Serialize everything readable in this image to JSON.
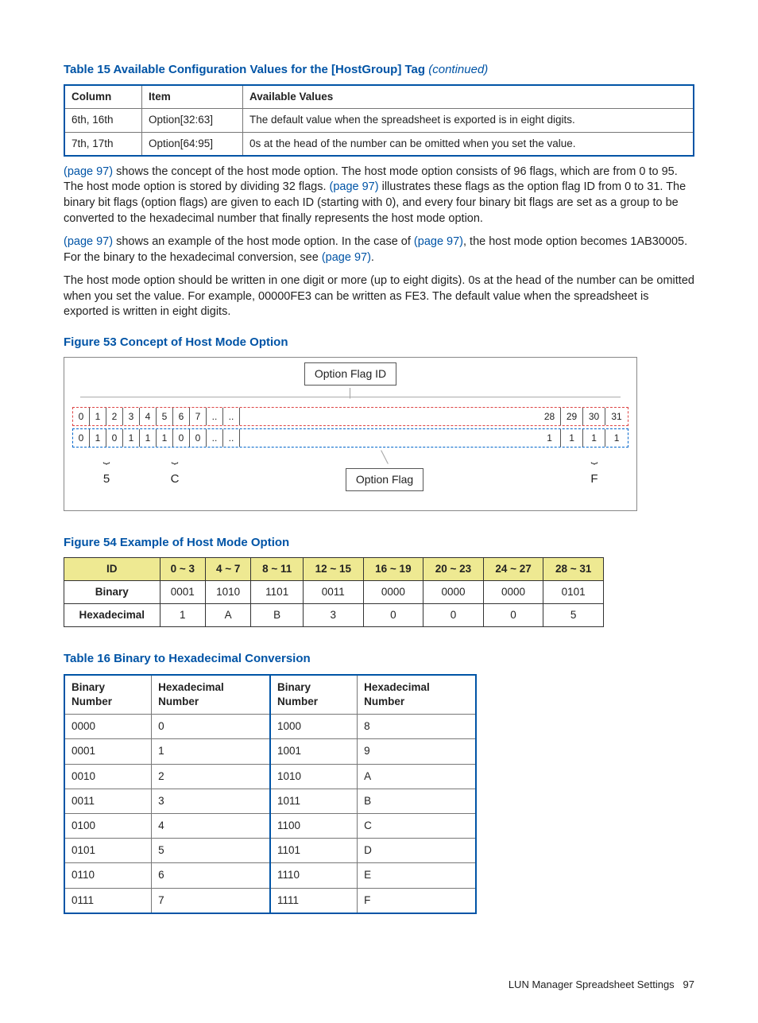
{
  "table15": {
    "caption": "Table 15 Available Configuration Values for the [HostGroup] Tag",
    "cont": "(continued)",
    "headers": [
      "Column",
      "Item",
      "Available Values"
    ],
    "rows": [
      [
        "6th, 16th",
        "Option[32:63]",
        "The default value when the spreadsheet is exported is in eight digits."
      ],
      [
        "7th, 17th",
        "Option[64:95]",
        "0s at the head of the number can be omitted when you set the value."
      ]
    ]
  },
  "para1a": " shows the concept of the host mode option. The host mode option consists of 96 flags, which are from 0 to 95. The host mode option is stored by dividing 32 flags. ",
  "para1b": " illustrates these flags as the option flag ID from 0 to 31. The binary bit flags (option flags) are given to each ID (starting with 0), and every four binary bit flags are set as a group to be converted to the hexadecimal number that finally represents the host mode option.",
  "para2a": " shows an example of the host mode option. In the case of ",
  "para2b": ", the host mode option becomes 1AB30005. For the binary to the hexadecimal conversion, see ",
  "para2c": ".",
  "para3": "The host mode option should be written in one digit or more (up to eight digits). 0s at the head of the number can be omitted when you set the value. For example, 00000FE3 can be written as FE3. The default value when the spreadsheet is exported is written in eight digits.",
  "pg97": "(page 97)",
  "fig53": {
    "caption": "Figure 53 Concept of Host Mode Option",
    "optflagid": "Option Flag ID",
    "optflag": "Option Flag",
    "idrow": [
      "0",
      "1",
      "2",
      "3",
      "4",
      "5",
      "6",
      "7",
      "..",
      "..",
      "",
      "",
      "",
      "",
      "",
      "",
      "",
      "",
      "",
      "",
      "",
      "",
      "",
      "",
      "",
      "",
      "",
      "",
      "28",
      "29",
      "30",
      "31"
    ],
    "binrow": [
      "0",
      "1",
      "0",
      "1",
      "1",
      "1",
      "0",
      "0",
      "..",
      "..",
      "",
      "",
      "",
      "",
      "",
      "",
      "",
      "",
      "",
      "",
      "",
      "",
      "",
      "",
      "",
      "",
      "",
      "",
      "1",
      "1",
      "1",
      "1"
    ],
    "hex": [
      "5",
      "C",
      "F"
    ]
  },
  "fig54": {
    "caption": "Figure 54 Example of Host Mode Option",
    "headers": [
      "ID",
      "0 ~ 3",
      "4 ~ 7",
      "8 ~ 11",
      "12 ~ 15",
      "16 ~ 19",
      "20 ~ 23",
      "24 ~ 27",
      "28 ~ 31"
    ],
    "binary": [
      "Binary",
      "0001",
      "1010",
      "1101",
      "0011",
      "0000",
      "0000",
      "0000",
      "0101"
    ],
    "hex": [
      "Hexadecimal",
      "1",
      "A",
      "B",
      "3",
      "0",
      "0",
      "0",
      "5"
    ]
  },
  "table16": {
    "caption": "Table 16 Binary to Hexadecimal Conversion",
    "headers": [
      "Binary Number",
      "Hexadecimal Number",
      "Binary Number",
      "Hexadecimal Number"
    ],
    "rows": [
      [
        "0000",
        "0",
        "1000",
        "8"
      ],
      [
        "0001",
        "1",
        "1001",
        "9"
      ],
      [
        "0010",
        "2",
        "1010",
        "A"
      ],
      [
        "0011",
        "3",
        "1011",
        "B"
      ],
      [
        "0100",
        "4",
        "1100",
        "C"
      ],
      [
        "0101",
        "5",
        "1101",
        "D"
      ],
      [
        "0110",
        "6",
        "1110",
        "E"
      ],
      [
        "0111",
        "7",
        "1111",
        "F"
      ]
    ]
  },
  "footer": {
    "text": "LUN Manager Spreadsheet Settings",
    "page": "97"
  }
}
